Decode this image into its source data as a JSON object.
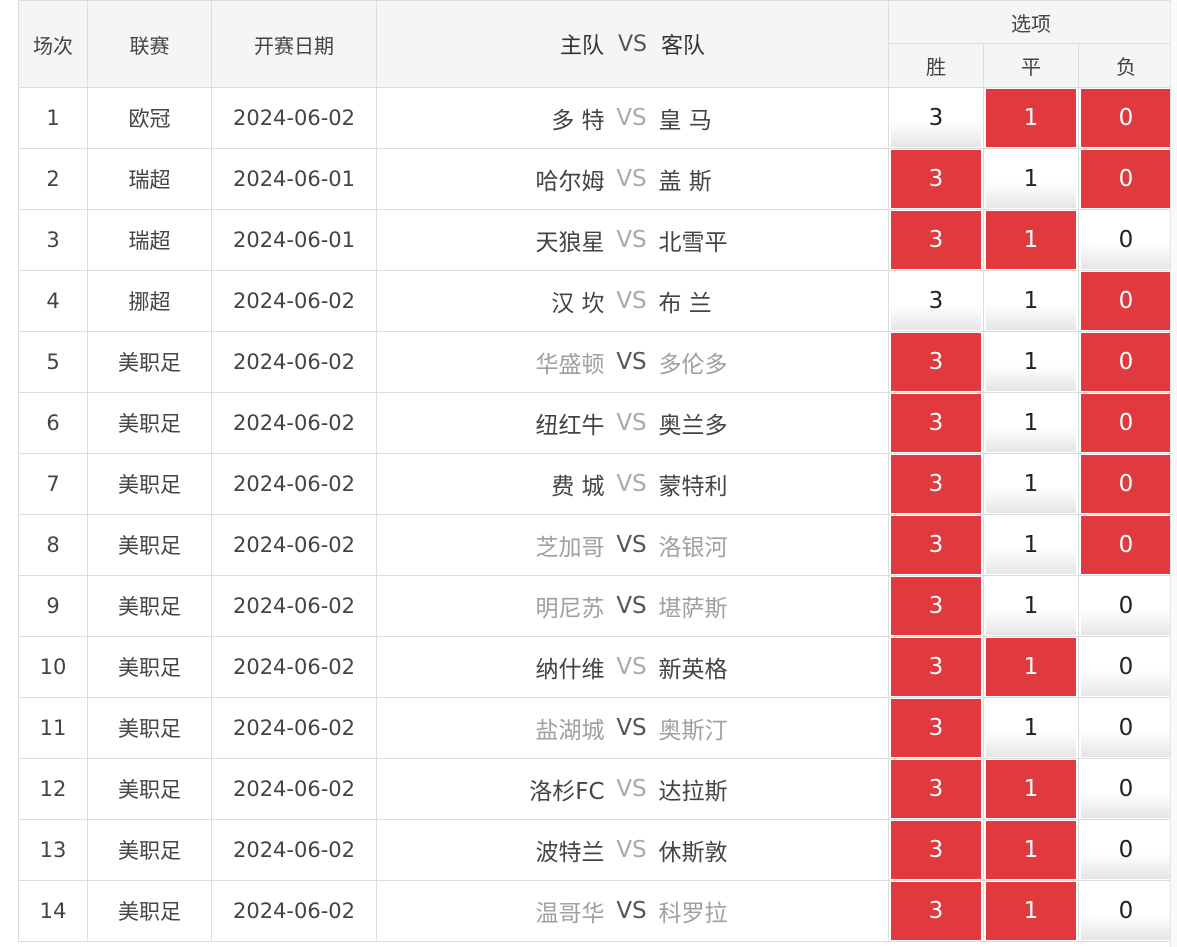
{
  "header": {
    "index": "场次",
    "league": "联赛",
    "date": "开赛日期",
    "home": "主队",
    "vs": "VS",
    "away": "客队",
    "options": "选项",
    "win": "胜",
    "draw": "平",
    "lose": "负"
  },
  "rows": [
    {
      "no": "1",
      "league": "欧冠",
      "date": "2024-06-02",
      "home": "多 特",
      "vs": "VS",
      "away": "皇 马",
      "w": "3",
      "d": "1",
      "l": "0"
    },
    {
      "no": "2",
      "league": "瑞超",
      "date": "2024-06-01",
      "home": "哈尔姆",
      "vs": "VS",
      "away": "盖 斯",
      "w": "3",
      "d": "1",
      "l": "0"
    },
    {
      "no": "3",
      "league": "瑞超",
      "date": "2024-06-01",
      "home": "天狼星",
      "vs": "VS",
      "away": "北雪平",
      "w": "3",
      "d": "1",
      "l": "0"
    },
    {
      "no": "4",
      "league": "挪超",
      "date": "2024-06-02",
      "home": "汉 坎",
      "vs": "VS",
      "away": "布 兰",
      "w": "3",
      "d": "1",
      "l": "0"
    },
    {
      "no": "5",
      "league": "美职足",
      "date": "2024-06-02",
      "home": "华盛顿",
      "vs": "VS",
      "away": "多伦多",
      "w": "3",
      "d": "1",
      "l": "0"
    },
    {
      "no": "6",
      "league": "美职足",
      "date": "2024-06-02",
      "home": "纽红牛",
      "vs": "VS",
      "away": "奥兰多",
      "w": "3",
      "d": "1",
      "l": "0"
    },
    {
      "no": "7",
      "league": "美职足",
      "date": "2024-06-02",
      "home": "费 城",
      "vs": "VS",
      "away": "蒙特利",
      "w": "3",
      "d": "1",
      "l": "0"
    },
    {
      "no": "8",
      "league": "美职足",
      "date": "2024-06-02",
      "home": "芝加哥",
      "vs": "VS",
      "away": "洛银河",
      "w": "3",
      "d": "1",
      "l": "0"
    },
    {
      "no": "9",
      "league": "美职足",
      "date": "2024-06-02",
      "home": "明尼苏",
      "vs": "VS",
      "away": "堪萨斯",
      "w": "3",
      "d": "1",
      "l": "0"
    },
    {
      "no": "10",
      "league": "美职足",
      "date": "2024-06-02",
      "home": "纳什维",
      "vs": "VS",
      "away": "新英格",
      "w": "3",
      "d": "1",
      "l": "0"
    },
    {
      "no": "11",
      "league": "美职足",
      "date": "2024-06-02",
      "home": "盐湖城",
      "vs": "VS",
      "away": "奥斯汀",
      "w": "3",
      "d": "1",
      "l": "0"
    },
    {
      "no": "12",
      "league": "美职足",
      "date": "2024-06-02",
      "home": "洛杉FC",
      "vs": "VS",
      "away": "达拉斯",
      "w": "3",
      "d": "1",
      "l": "0"
    },
    {
      "no": "13",
      "league": "美职足",
      "date": "2024-06-02",
      "home": "波特兰",
      "vs": "VS",
      "away": "休斯敦",
      "w": "3",
      "d": "1",
      "l": "0"
    },
    {
      "no": "14",
      "league": "美职足",
      "date": "2024-06-02",
      "home": "温哥华",
      "vs": "VS",
      "away": "科罗拉",
      "w": "3",
      "d": "1",
      "l": "0"
    }
  ]
}
